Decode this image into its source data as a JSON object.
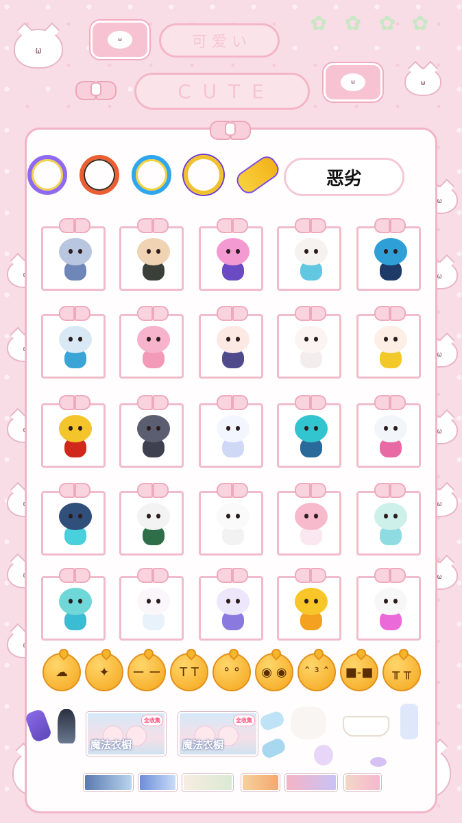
{
  "header": {
    "pill_top": "可 爱 い",
    "pill_bottom": "C U T E"
  },
  "profile": {
    "name_label": "恶劣"
  },
  "cat_face": "ω",
  "frames": [
    {
      "name": "purple-frame"
    },
    {
      "name": "orange-frame"
    },
    {
      "name": "blue-frame"
    },
    {
      "name": "gold-frame"
    },
    {
      "name": "yellow-stick-item"
    }
  ],
  "figures": [
    {
      "name": "figure-blue-princess",
      "head": "#b8c6e0",
      "body": "#6f86b8"
    },
    {
      "name": "figure-dark-warrior",
      "head": "#f0d3b2",
      "body": "#3a3f3a"
    },
    {
      "name": "figure-pink-hair-girl",
      "head": "#f49ad2",
      "body": "#6a4bc4"
    },
    {
      "name": "figure-white-llama",
      "head": "#f5f2f0",
      "body": "#62c8e2"
    },
    {
      "name": "figure-blue-robot",
      "head": "#2f9fd8",
      "body": "#1e3a66"
    },
    {
      "name": "figure-mech-bunny",
      "head": "#d8e9f5",
      "body": "#3aa4d6"
    },
    {
      "name": "figure-pink-eggy",
      "head": "#f6b3cb",
      "body": "#f39ab8"
    },
    {
      "name": "figure-sailor-eggy",
      "head": "#fde9e4",
      "body": "#4e4a8c"
    },
    {
      "name": "figure-white-eggy",
      "head": "#fbf4f3",
      "body": "#f4eded"
    },
    {
      "name": "figure-bee-eggy",
      "head": "#fdeee6",
      "body": "#f3c92a"
    },
    {
      "name": "figure-red-helmet",
      "head": "#f4c52a",
      "body": "#d1281c"
    },
    {
      "name": "figure-gray-wolf",
      "head": "#5b5e70",
      "body": "#3e4050"
    },
    {
      "name": "figure-ghost-cloud",
      "head": "#f3f6ff",
      "body": "#cfd9f6"
    },
    {
      "name": "figure-cat-robot",
      "head": "#32c4cf",
      "body": "#2a6a9a"
    },
    {
      "name": "figure-pink-bunny-robot",
      "head": "#f2f6fb",
      "body": "#e86aa5"
    },
    {
      "name": "figure-dark-cat",
      "head": "#304f7a",
      "body": "#4ad0dc"
    },
    {
      "name": "figure-panda-warrior",
      "head": "#f3f3f3",
      "body": "#2e6e48"
    },
    {
      "name": "figure-white-bunny-ghost",
      "head": "#fafafa",
      "body": "#f2f2f2"
    },
    {
      "name": "figure-pink-bear",
      "head": "#f7bacd",
      "body": "#fbe7ef"
    },
    {
      "name": "figure-mint-bird",
      "head": "#cdf0ea",
      "body": "#8fdbe2"
    },
    {
      "name": "figure-teal-dino",
      "head": "#6fd7d7",
      "body": "#3cbcd2"
    },
    {
      "name": "figure-white-pink-bunny",
      "head": "#fbf6fa",
      "body": "#e7f2fb"
    },
    {
      "name": "figure-purple-astronaut",
      "head": "#ece7fb",
      "body": "#8a7ae0"
    },
    {
      "name": "figure-yellow-duck-astro",
      "head": "#f8c628",
      "body": "#f4a020"
    },
    {
      "name": "figure-magenta-antenna",
      "head": "#f7f7f7",
      "body": "#ea6ad9"
    }
  ],
  "emojis": [
    {
      "name": "raincloud-emoji",
      "face": "☁"
    },
    {
      "name": "firework-emoji",
      "face": "✦"
    },
    {
      "name": "smug-emoji",
      "face": "ー ー"
    },
    {
      "name": "crying-emoji",
      "face": "T T"
    },
    {
      "name": "sweat-emoji",
      "face": "° °"
    },
    {
      "name": "shocked-emoji",
      "face": "◉ ◉"
    },
    {
      "name": "kiss-emoji",
      "face": "ˆ ³ ˆ"
    },
    {
      "name": "sunglasses-emoji",
      "face": "■-■"
    },
    {
      "name": "sob-emoji",
      "face": "╥ ╥"
    }
  ],
  "wardrobes": [
    {
      "label": "魔法衣橱",
      "badge": "全收集"
    },
    {
      "label": "魔法衣橱",
      "badge": "全收集"
    }
  ]
}
